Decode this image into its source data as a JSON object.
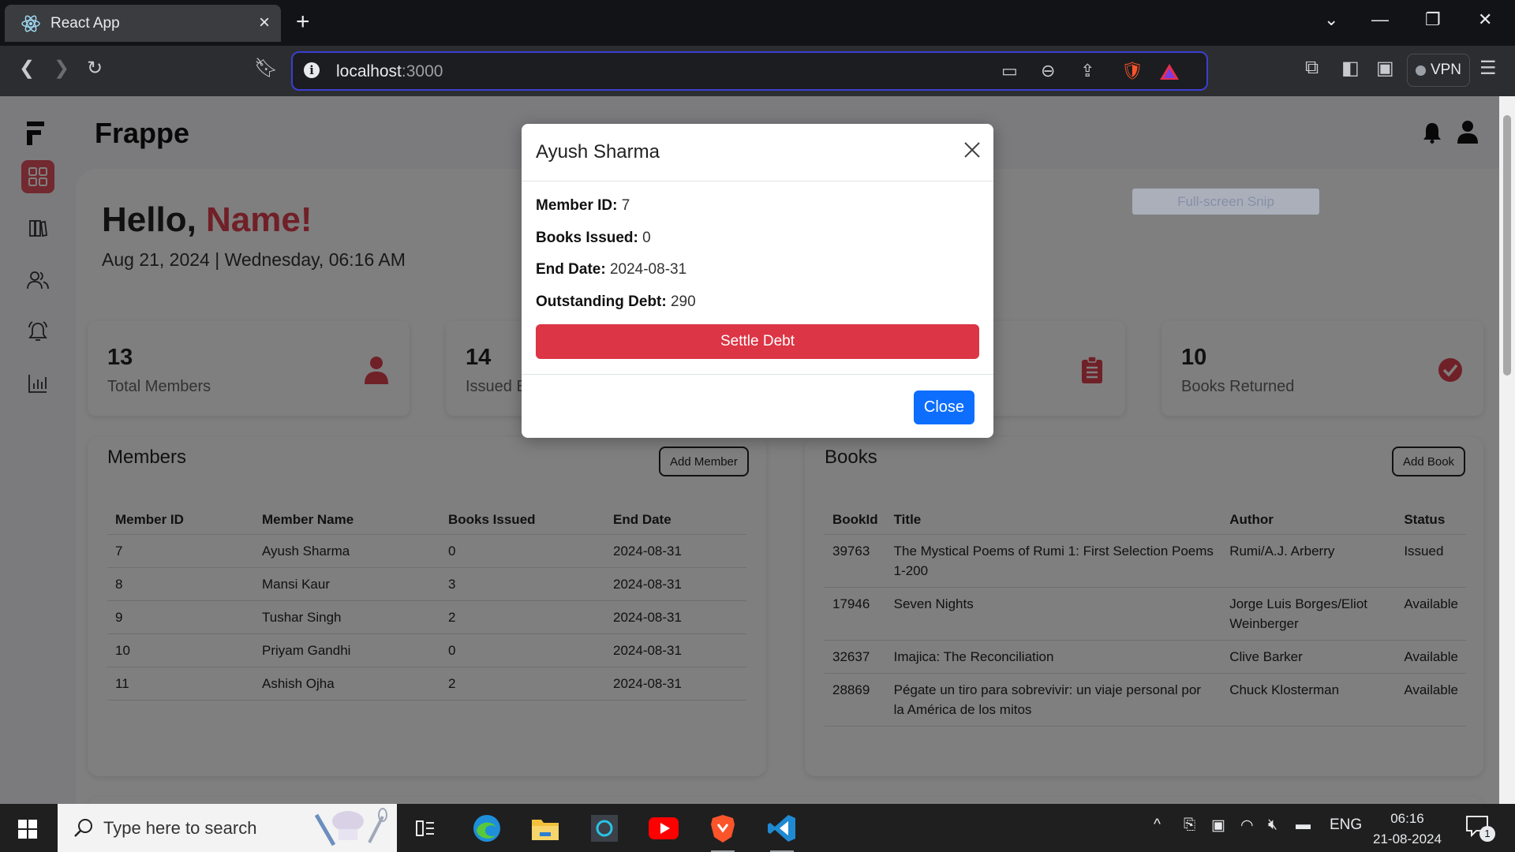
{
  "browser": {
    "tab_title": "React App",
    "url_host": "localhost",
    "url_port": ":3000",
    "vpn_label": "VPN"
  },
  "app": {
    "brand": "Frappe",
    "greeting": "Hello, ",
    "user_name": "Name!",
    "datetime": "Aug 21, 2024 | Wednesday, 06:16 AM",
    "accent_color": "#e0414f"
  },
  "stats": [
    {
      "value": "13",
      "label": "Total Members",
      "icon": "person-icon"
    },
    {
      "value": "14",
      "label": "Issued Books",
      "icon": "book-icon"
    },
    {
      "value": "",
      "label": "",
      "icon": "clipboard-icon"
    },
    {
      "value": "10",
      "label": "Books Returned",
      "icon": "check-circle-icon"
    }
  ],
  "members": {
    "title": "Members",
    "add_label": "Add Member",
    "columns": [
      "Member ID",
      "Member Name",
      "Books Issued",
      "End Date"
    ],
    "rows": [
      [
        "7",
        "Ayush Sharma",
        "0",
        "2024-08-31"
      ],
      [
        "8",
        "Mansi Kaur",
        "3",
        "2024-08-31"
      ],
      [
        "9",
        "Tushar Singh",
        "2",
        "2024-08-31"
      ],
      [
        "10",
        "Priyam Gandhi",
        "0",
        "2024-08-31"
      ],
      [
        "11",
        "Ashish Ojha",
        "2",
        "2024-08-31"
      ]
    ]
  },
  "books": {
    "title": "Books",
    "add_label": "Add Book",
    "columns": [
      "BookId",
      "Title",
      "Author",
      "Status"
    ],
    "rows": [
      [
        "39763",
        "The Mystical Poems of Rumi 1: First Selection Poems 1-200",
        "Rumi/A.J. Arberry",
        "Issued"
      ],
      [
        "17946",
        "Seven Nights",
        "Jorge Luis Borges/Eliot Weinberger",
        "Available"
      ],
      [
        "32637",
        "Imajica: The Reconciliation",
        "Clive Barker",
        "Available"
      ],
      [
        "28869",
        "Pégate un tiro para sobrevivir: un viaje personal por la América de los mitos",
        "Chuck Klosterman",
        "Available"
      ]
    ]
  },
  "snip_label": "Full-screen Snip",
  "modal": {
    "title": "Ayush Sharma",
    "member_id_label": "Member ID:",
    "member_id": " 7",
    "books_issued_label": "Books Issued:",
    "books_issued": " 0",
    "end_date_label": "End Date:",
    "end_date": " 2024-08-31",
    "debt_label": "Outstanding Debt:",
    "debt": " 290",
    "settle_label": "Settle Debt",
    "close_label": "Close"
  },
  "taskbar": {
    "search_placeholder": "Type here to search",
    "lang": "ENG",
    "time": "06:16",
    "date": "21-08-2024",
    "notification_count": "1"
  }
}
